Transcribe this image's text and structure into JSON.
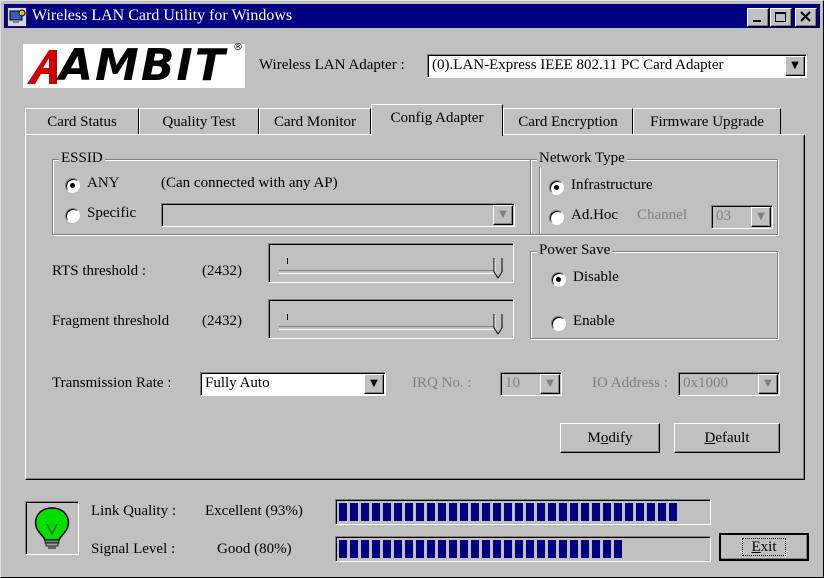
{
  "window": {
    "title": "Wireless LAN Card Utility for Windows",
    "controls": [
      "_",
      "□",
      "×"
    ]
  },
  "logo": {
    "text": "AMBIT",
    "reg": "®"
  },
  "adapter": {
    "label": "Wireless LAN Adapter :",
    "value": "(0).LAN-Express IEEE 802.11 PC Card Adapter"
  },
  "tabs": [
    "Card Status",
    "Quality Test",
    "Card Monitor",
    "Config Adapter",
    "Card Encryption",
    "Firmware Upgrade"
  ],
  "active_tab": "Config Adapter",
  "essid": {
    "title": "ESSID",
    "any_label": "ANY",
    "any_note": "(Can connected with any AP)",
    "specific_label": "Specific",
    "specific_value": "",
    "selected": "ANY"
  },
  "network_type": {
    "title": "Network Type",
    "infrastructure_label": "Infrastructure",
    "adhoc_label": "Ad.Hoc",
    "channel_label": "Channel",
    "channel_value": "03",
    "selected": "Infrastructure"
  },
  "rts": {
    "label": "RTS threshold :",
    "value": "(2432)"
  },
  "fragment": {
    "label": "Fragment threshold",
    "value": "(2432)"
  },
  "power_save": {
    "title": "Power Save",
    "disable_label": "Disable",
    "enable_label": "Enable",
    "selected": "Disable"
  },
  "transmission": {
    "label": "Transmission Rate :",
    "value": "Fully Auto"
  },
  "irq": {
    "label": "IRQ No. :",
    "value": "10"
  },
  "io": {
    "label": "IO Address :",
    "value": "0x1000"
  },
  "buttons": {
    "modify": "Modify",
    "default": "Default",
    "exit": "Exit"
  },
  "link_quality": {
    "label": "Link Quality :",
    "value": "Excellent (93%)",
    "level": 0.93
  },
  "signal_level": {
    "label": "Signal Level :",
    "value": "Good (80%)",
    "level": 0.8
  },
  "colors": {
    "titlebar": "#000080",
    "bar_fill": "#000080",
    "bulb": "#00e000",
    "face": "#c0c0c0"
  }
}
